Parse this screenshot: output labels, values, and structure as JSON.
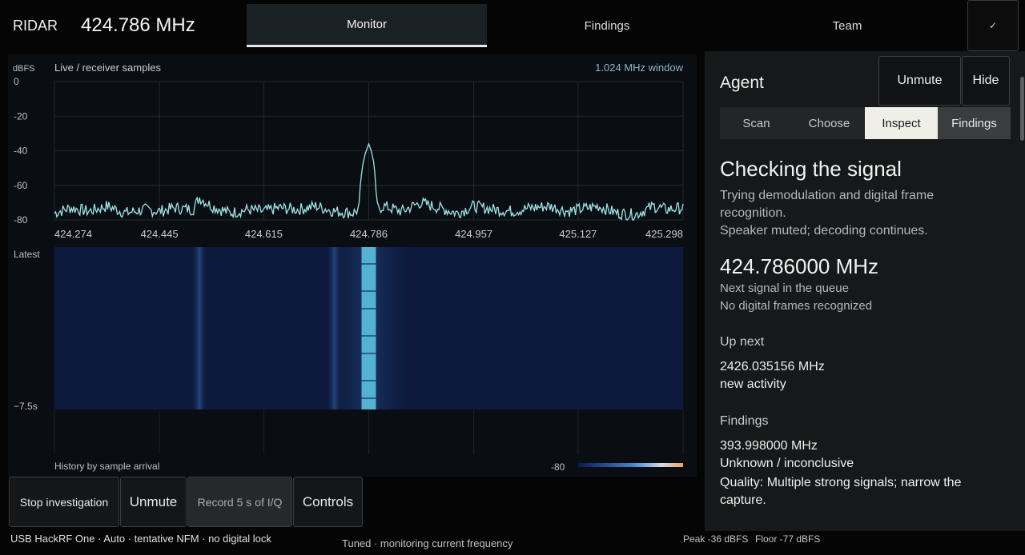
{
  "header": {
    "app_title": "RIDAR",
    "frequency": "424.786 MHz",
    "tabs": [
      {
        "label": "Monitor",
        "active": true
      },
      {
        "label": "Findings",
        "active": false
      },
      {
        "label": "Team",
        "active": false
      }
    ],
    "confirm_icon": "check-icon",
    "confirm_glyph": "✓"
  },
  "spectrum": {
    "title": "Live / receiver samples",
    "window": "1.024 MHz window",
    "y_unit": "dBFS",
    "history_label": "History by sample arrival",
    "time_top": "Latest",
    "time_bottom": "−7.5s",
    "colorbar_label": "-80",
    "colors": {
      "trace": "#9fe3e8",
      "waterfall_bg": "#0d1a3d",
      "signal": "#5ec8e6"
    }
  },
  "chart_data": {
    "type": "line",
    "ylabel": "dBFS",
    "xlabel": "",
    "title": "Live / receiver samples",
    "x_ticks": [
      "424.274",
      "424.445",
      "424.615",
      "424.786",
      "424.957",
      "425.127",
      "425.298"
    ],
    "y_ticks": [
      "0",
      "-20",
      "-40",
      "-60",
      "-80"
    ],
    "xlim": [
      424.274,
      425.298
    ],
    "ylim": [
      -80,
      0
    ],
    "grid": true,
    "series": [
      {
        "x": [
          424.274,
          424.3,
          424.33,
          424.36,
          424.39,
          424.42,
          424.445,
          424.47,
          424.5,
          424.51,
          424.53,
          424.56,
          424.59,
          424.615,
          424.64,
          424.67,
          424.7,
          424.73,
          424.76,
          424.77,
          424.775,
          424.78,
          424.786,
          424.79,
          424.795,
          424.8,
          424.81,
          424.84,
          424.87,
          424.9,
          424.93,
          424.957,
          424.99,
          425.02,
          425.05,
          425.08,
          425.11,
          425.127,
          425.16,
          425.19,
          425.22,
          425.25,
          425.27,
          425.298
        ],
        "values": [
          -76,
          -73,
          -75,
          -72,
          -76,
          -74,
          -75,
          -73,
          -74,
          -67,
          -72,
          -76,
          -74,
          -75,
          -73,
          -74,
          -72,
          -75,
          -76,
          -74,
          -50,
          -42,
          -36,
          -40,
          -48,
          -74,
          -72,
          -75,
          -70,
          -73,
          -76,
          -72,
          -74,
          -75,
          -73,
          -72,
          -75,
          -74,
          -72,
          -76,
          -77,
          -72,
          -74,
          -73
        ]
      }
    ],
    "waterfall": {
      "strong_signal_mhz": 424.786,
      "faint_bands_mhz": [
        424.51,
        424.73
      ],
      "history_seconds": 7.5
    }
  },
  "controls": {
    "stop": "Stop investigation",
    "unmute": "Unmute",
    "record": "Record 5 s of I/Q",
    "controls": "Controls"
  },
  "status": {
    "device": "USB HackRF One · Auto · tentative NFM · no digital lock",
    "state": "Tuned · monitoring current frequency",
    "peak": "Peak -36 dBFS",
    "floor": "Floor -77 dBFS"
  },
  "agent": {
    "title": "Agent",
    "unmute": "Unmute",
    "hide": "Hide",
    "steps": [
      {
        "label": "Scan"
      },
      {
        "label": "Choose"
      },
      {
        "label": "Inspect",
        "active": true
      },
      {
        "label": "Findings"
      }
    ],
    "heading": "Checking the signal",
    "desc_line1": "Trying demodulation and digital frame recognition.",
    "desc_line2": "Speaker muted; decoding continues.",
    "frequency": "424.786000 MHz",
    "next": "Next signal in the queue",
    "frames": "No digital frames recognized",
    "upnext_heading": "Up next",
    "upnext_freq": "2426.035156 MHz",
    "upnext_note": "new activity",
    "findings_heading": "Findings",
    "finding_freq": "393.998000 MHz",
    "finding_class": "Unknown / inconclusive",
    "finding_quality": "Quality: Multiple strong signals; narrow the capture."
  }
}
